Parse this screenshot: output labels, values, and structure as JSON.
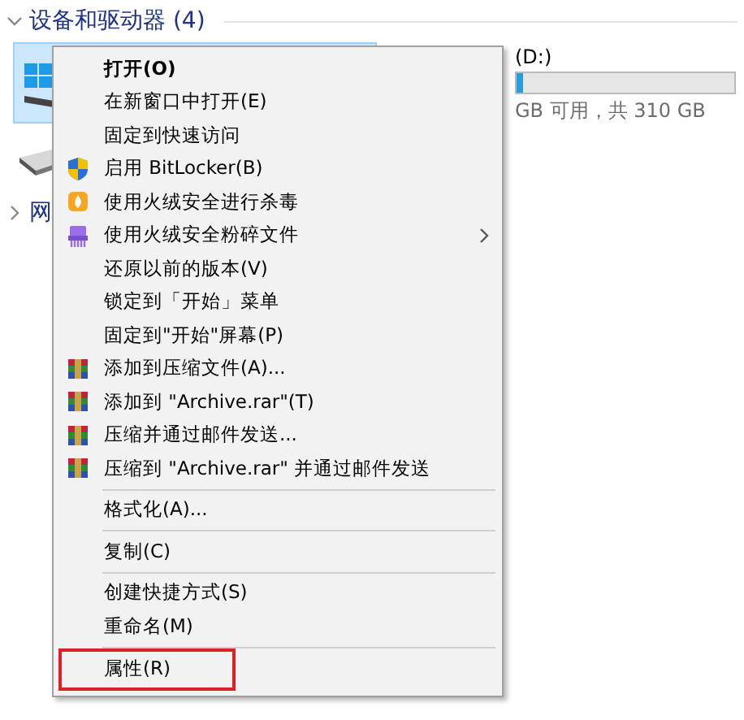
{
  "groups": [
    {
      "title": "设备和驱动器 (4)",
      "expanded": true
    },
    {
      "title": "网",
      "expanded": false
    }
  ],
  "drives": [
    {
      "selected": true
    },
    {
      "label": "(D:)",
      "level": 0.03,
      "free": "GB 可用，共 310 GB"
    }
  ],
  "context_menu": {
    "items": [
      {
        "kind": "default",
        "label": "打开(O)",
        "submenu": false,
        "marked": false
      },
      {
        "kind": "item",
        "label": "在新窗口中打开(E)",
        "submenu": false,
        "marked": false
      },
      {
        "kind": "item",
        "label": "固定到快速访问",
        "submenu": false,
        "marked": false
      },
      {
        "kind": "shield",
        "label": "启用 BitLocker(B)",
        "submenu": false,
        "marked": false
      },
      {
        "kind": "flame",
        "label": "使用火绒安全进行杀毒",
        "submenu": false,
        "marked": false
      },
      {
        "kind": "shredder",
        "label": "使用火绒安全粉碎文件",
        "submenu": true,
        "marked": false
      },
      {
        "kind": "item",
        "label": "还原以前的版本(V)",
        "submenu": false,
        "marked": false
      },
      {
        "kind": "item",
        "label": "锁定到「开始」菜单",
        "submenu": false,
        "marked": false
      },
      {
        "kind": "item",
        "label": "固定到\"开始\"屏幕(P)",
        "submenu": false,
        "marked": false
      },
      {
        "kind": "archive",
        "label": "添加到压缩文件(A)...",
        "submenu": false,
        "marked": false
      },
      {
        "kind": "archive",
        "label": "添加到 \"Archive.rar\"(T)",
        "submenu": false,
        "marked": false
      },
      {
        "kind": "archive",
        "label": "压缩并通过邮件发送...",
        "submenu": false,
        "marked": false
      },
      {
        "kind": "archive",
        "label": "压缩到 \"Archive.rar\" 并通过邮件发送",
        "submenu": false,
        "marked": false
      },
      {
        "kind": "separator"
      },
      {
        "kind": "item",
        "label": "格式化(A)...",
        "submenu": false,
        "marked": false
      },
      {
        "kind": "separator"
      },
      {
        "kind": "item",
        "label": "复制(C)",
        "submenu": false,
        "marked": false
      },
      {
        "kind": "separator"
      },
      {
        "kind": "item",
        "label": "创建快捷方式(S)",
        "submenu": false,
        "marked": false
      },
      {
        "kind": "item",
        "label": "重命名(M)",
        "submenu": false,
        "marked": false
      },
      {
        "kind": "separator"
      },
      {
        "kind": "item",
        "label": "属性(R)",
        "submenu": false,
        "marked": true
      }
    ]
  }
}
